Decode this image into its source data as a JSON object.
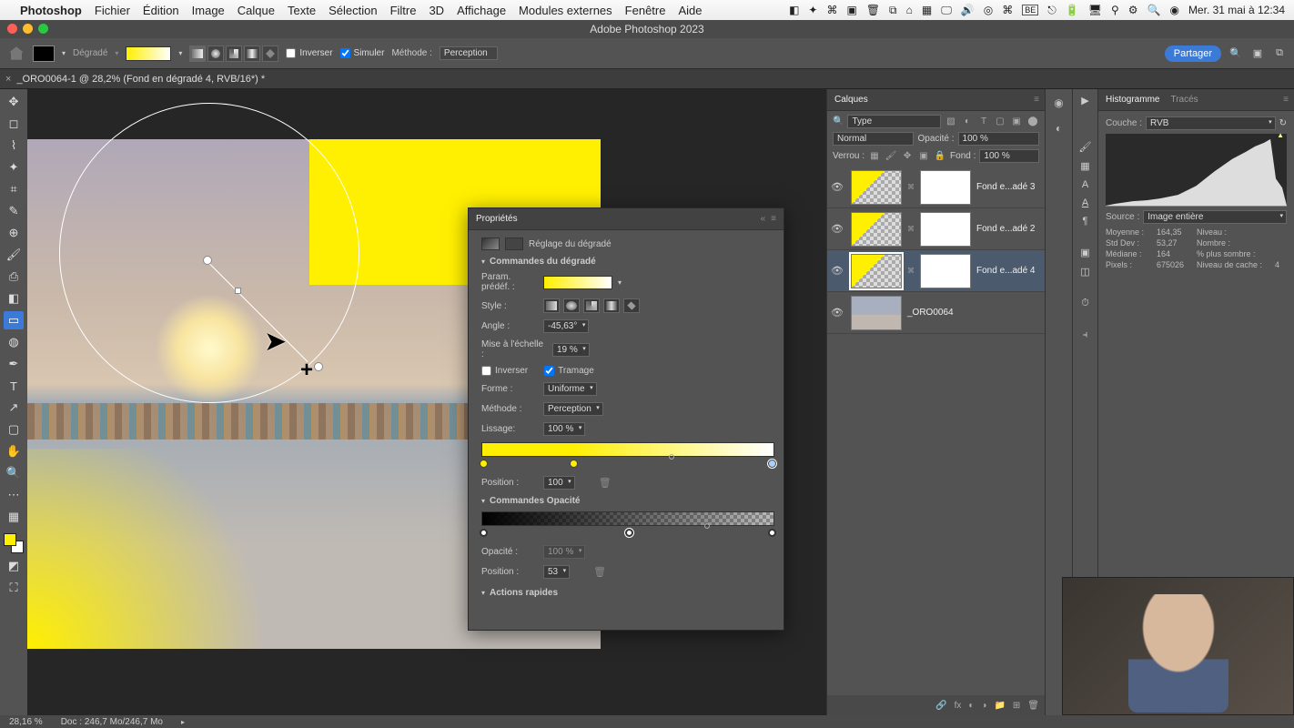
{
  "menubar": {
    "app_name": "Photoshop",
    "items": [
      "Fichier",
      "Édition",
      "Image",
      "Calque",
      "Texte",
      "Sélection",
      "Filtre",
      "3D",
      "Affichage",
      "Modules externes",
      "Fenêtre",
      "Aide"
    ],
    "clock": "Mer. 31 mai à 12:34"
  },
  "titlebar": {
    "title": "Adobe Photoshop 2023"
  },
  "optbar": {
    "preset_label": "Dégradé",
    "invert_label": "Inverser",
    "simulate_label": "Simuler",
    "method_label": "Méthode :",
    "method_value": "Perception",
    "share_label": "Partager"
  },
  "doctab": {
    "title": "_ORO0064-1 @ 28,2% (Fond en dégradé 4, RVB/16*) *"
  },
  "properties": {
    "tab": "Propriétés",
    "adjust_label": "Réglage du dégradé",
    "section_gradient": "Commandes du dégradé",
    "preset_label": "Param. prédéf. :",
    "style_label": "Style :",
    "angle_label": "Angle :",
    "angle_value": "-45,63°",
    "scale_label": "Mise à l'échelle :",
    "scale_value": "19 %",
    "invert_label": "Inverser",
    "dither_label": "Tramage",
    "shape_label": "Forme :",
    "shape_value": "Uniforme",
    "method_label": "Méthode :",
    "method_value": "Perception",
    "smooth_label": "Lissage:",
    "smooth_value": "100 %",
    "position_label": "Position :",
    "position_value": "100",
    "section_opacity": "Commandes Opacité",
    "opacity_label": "Opacité :",
    "opacity_value": "100 %",
    "opa_pos_value": "53",
    "section_quick": "Actions rapides"
  },
  "layers": {
    "tab": "Calques",
    "type_label": "Type",
    "blend_value": "Normal",
    "opacity_label": "Opacité :",
    "opacity_value": "100 %",
    "lock_label": "Verrou :",
    "fill_label": "Fond :",
    "fill_value": "100 %",
    "items": [
      {
        "name": "Fond e...adé 3"
      },
      {
        "name": "Fond e...adé 2"
      },
      {
        "name": "Fond e...adé 4"
      },
      {
        "name": "_ORO0064"
      }
    ]
  },
  "hist": {
    "tab_hist": "Histogramme",
    "tab_trace": "Tracés",
    "channel_label": "Couche :",
    "channel_value": "RVB",
    "source_label": "Source :",
    "source_value": "Image entière",
    "stats": {
      "mean_l": "Moyenne :",
      "mean_v": "164,35",
      "std_l": "Std Dev :",
      "std_v": "53,27",
      "med_l": "Médiane :",
      "med_v": "164",
      "pix_l": "Pixels :",
      "pix_v": "675026",
      "lvl_l": "Niveau :",
      "lvl_v": "",
      "cnt_l": "Nombre :",
      "cnt_v": "",
      "pct_l": "% plus sombre :",
      "pct_v": "",
      "cache_l": "Niveau de cache :",
      "cache_v": "4"
    }
  },
  "statusbar": {
    "zoom": "28,16 %",
    "doc": "Doc : 246,7 Mo/246,7 Mo"
  }
}
